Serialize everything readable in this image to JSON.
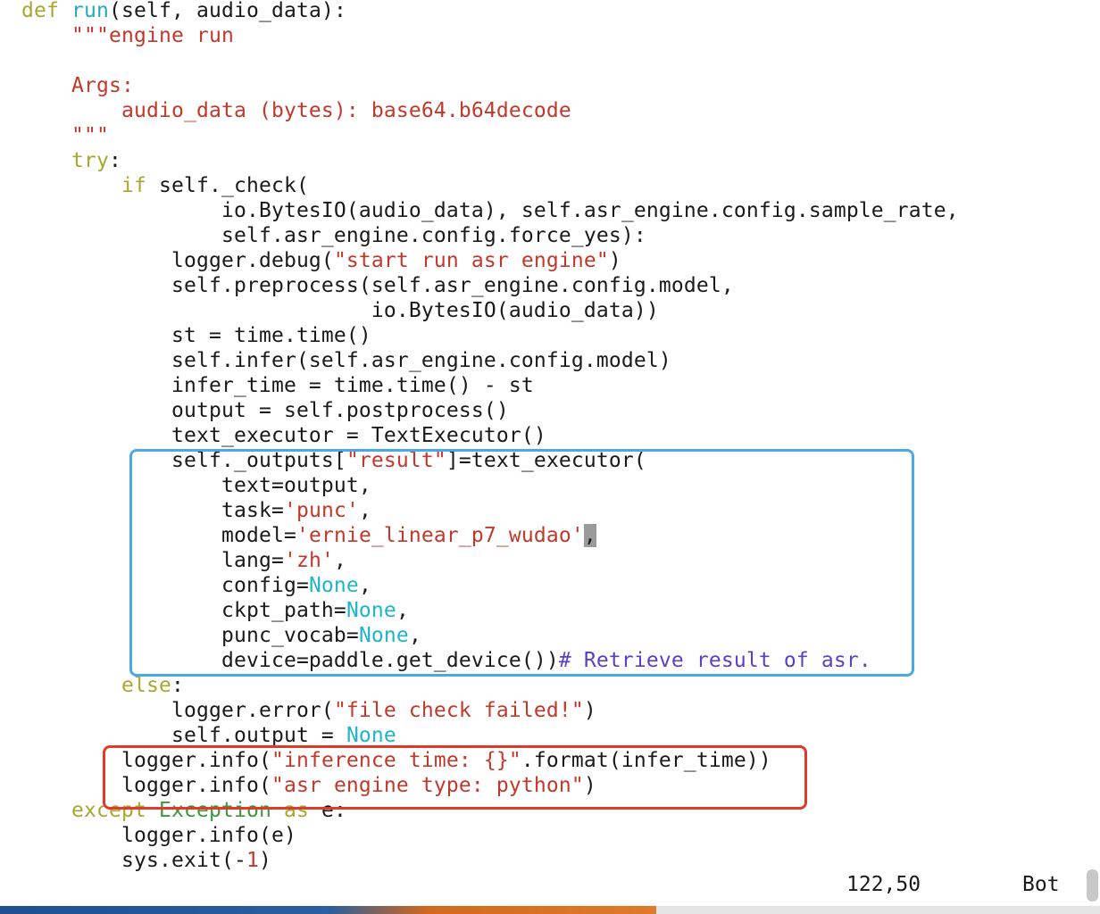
{
  "editor": {
    "lines": [
      [
        [
          "kw",
          "def "
        ],
        [
          "fn",
          "run"
        ],
        [
          "plain",
          "(self, audio_data):"
        ]
      ],
      [
        [
          "str",
          "    \"\"\"engine run"
        ]
      ],
      [],
      [
        [
          "str",
          "    Args:"
        ]
      ],
      [
        [
          "str",
          "        audio_data (bytes): base64.b64decode"
        ]
      ],
      [
        [
          "str",
          "    \"\"\""
        ]
      ],
      [
        [
          "plain",
          "    "
        ],
        [
          "kw",
          "try"
        ],
        [
          "plain",
          ":"
        ]
      ],
      [
        [
          "plain",
          "        "
        ],
        [
          "kw",
          "if"
        ],
        [
          "plain",
          " self._check("
        ]
      ],
      [
        [
          "plain",
          "                io.BytesIO(audio_data), self.asr_engine.config.sample_rate,"
        ]
      ],
      [
        [
          "plain",
          "                self.asr_engine.config.force_yes):"
        ]
      ],
      [
        [
          "plain",
          "            logger.debug("
        ],
        [
          "str",
          "\"start run asr engine\""
        ],
        [
          "plain",
          ")"
        ]
      ],
      [
        [
          "plain",
          "            self.preprocess(self.asr_engine.config.model,"
        ]
      ],
      [
        [
          "plain",
          "                            io.BytesIO(audio_data))"
        ]
      ],
      [
        [
          "plain",
          "            st = time.time()"
        ]
      ],
      [
        [
          "plain",
          "            self.infer(self.asr_engine.config.model)"
        ]
      ],
      [
        [
          "plain",
          "            infer_time = time.time() - st"
        ]
      ],
      [
        [
          "plain",
          "            output = self.postprocess()"
        ]
      ],
      [
        [
          "plain",
          "            text_executor = TextExecutor()"
        ]
      ],
      [
        [
          "plain",
          "            self._outputs["
        ],
        [
          "str",
          "\"result\""
        ],
        [
          "plain",
          "]=text_executor("
        ]
      ],
      [
        [
          "plain",
          "                text=output,"
        ]
      ],
      [
        [
          "plain",
          "                task="
        ],
        [
          "str",
          "'punc'"
        ],
        [
          "plain",
          ","
        ]
      ],
      [
        [
          "plain",
          "                model="
        ],
        [
          "str",
          "'ernie_linear_p7_wudao'"
        ],
        [
          "cur",
          ","
        ]
      ],
      [
        [
          "plain",
          "                lang="
        ],
        [
          "str",
          "'zh'"
        ],
        [
          "plain",
          ","
        ]
      ],
      [
        [
          "plain",
          "                config="
        ],
        [
          "none",
          "None"
        ],
        [
          "plain",
          ","
        ]
      ],
      [
        [
          "plain",
          "                ckpt_path="
        ],
        [
          "none",
          "None"
        ],
        [
          "plain",
          ","
        ]
      ],
      [
        [
          "plain",
          "                punc_vocab="
        ],
        [
          "none",
          "None"
        ],
        [
          "plain",
          ","
        ]
      ],
      [
        [
          "plain",
          "                device=paddle.get_device())"
        ],
        [
          "cm",
          "# Retrieve result of asr."
        ]
      ],
      [
        [
          "plain",
          "        "
        ],
        [
          "kw",
          "else"
        ],
        [
          "plain",
          ":"
        ]
      ],
      [
        [
          "plain",
          "            logger.error("
        ],
        [
          "str",
          "\"file check failed!\""
        ],
        [
          "plain",
          ")"
        ]
      ],
      [
        [
          "plain",
          "            self.output = "
        ],
        [
          "none",
          "None"
        ]
      ],
      [
        [
          "plain",
          "        logger.info("
        ],
        [
          "str",
          "\"inference time: {}\""
        ],
        [
          "plain",
          ".format(infer_time))"
        ]
      ],
      [
        [
          "plain",
          "        logger.info("
        ],
        [
          "str",
          "\"asr engine type: python\""
        ],
        [
          "plain",
          ")"
        ]
      ],
      [
        [
          "plain",
          "    "
        ],
        [
          "kw",
          "except"
        ],
        [
          "plain",
          " "
        ],
        [
          "exc",
          "Exception"
        ],
        [
          "plain",
          " "
        ],
        [
          "kw",
          "as"
        ],
        [
          "plain",
          " e:"
        ]
      ],
      [
        [
          "plain",
          "        logger.info(e)"
        ]
      ],
      [
        [
          "plain",
          "        sys.exit(-"
        ],
        [
          "num",
          "1"
        ],
        [
          "plain",
          ")"
        ]
      ]
    ]
  },
  "status": {
    "position": "122,50",
    "scroll": "Bot"
  },
  "colors": {
    "highlight_blue": "#4aa8e8",
    "highlight_red": "#e03a2a"
  }
}
